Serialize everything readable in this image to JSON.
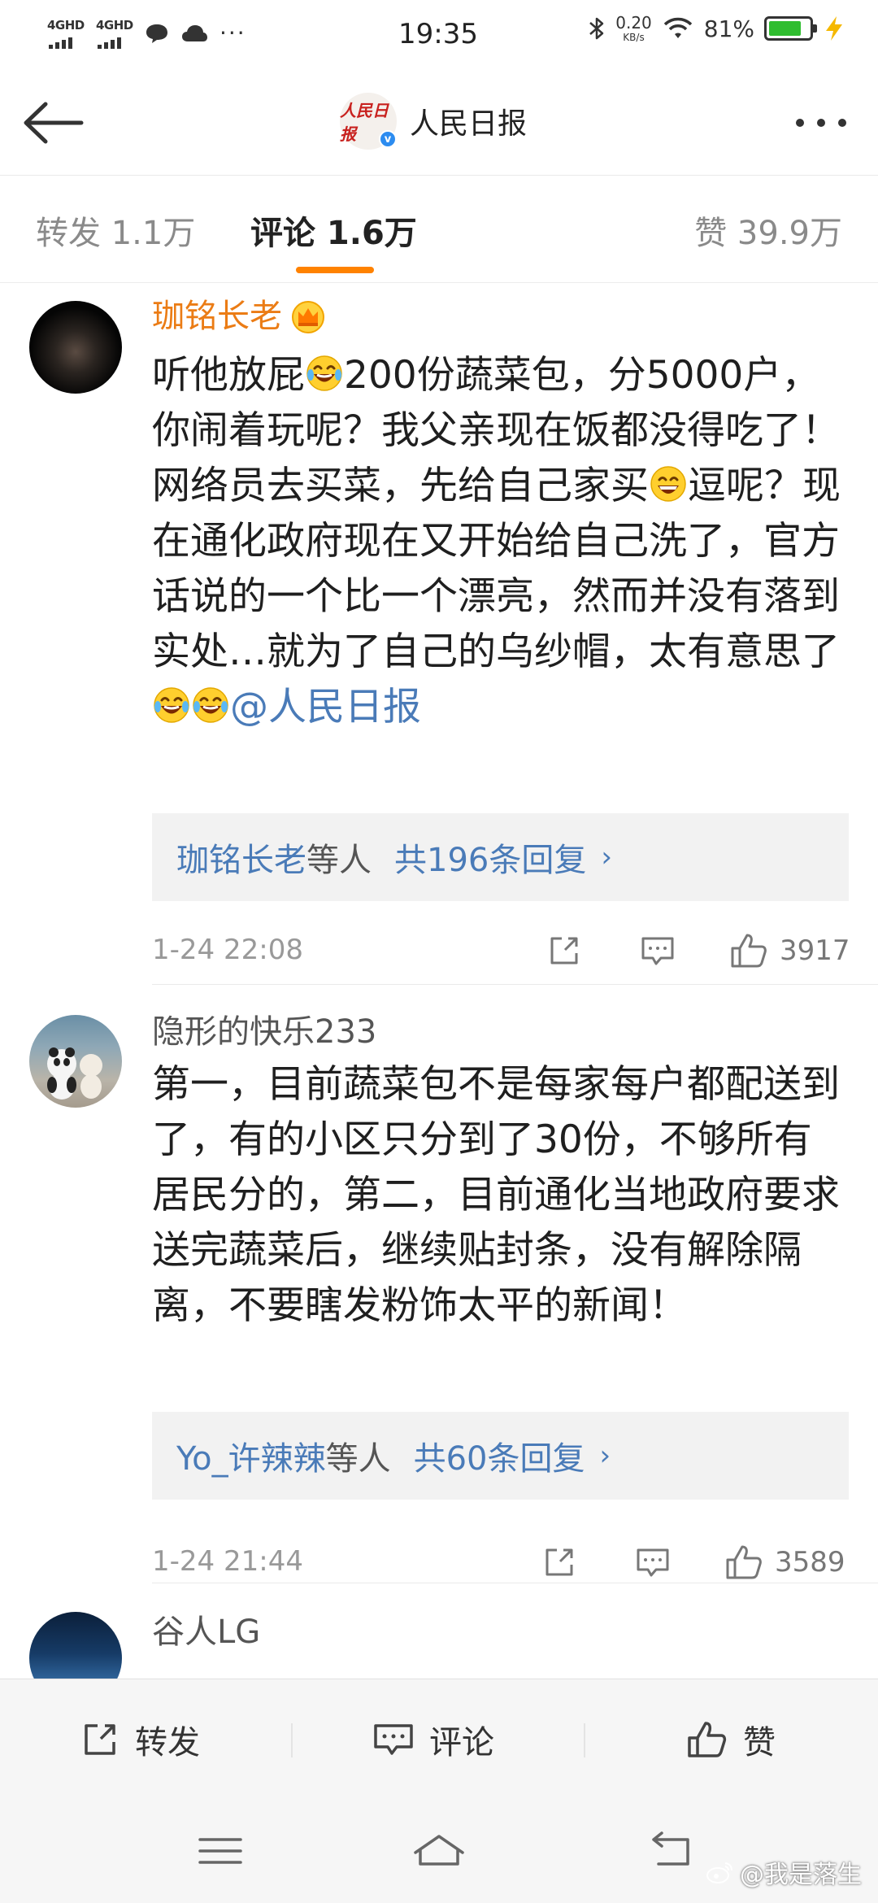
{
  "status_bar": {
    "network1": "4GHD",
    "network2": "4GHD",
    "more": "···",
    "time": "19:35",
    "speed_value": "0.20",
    "speed_unit": "KB/s",
    "battery_pct": "81%",
    "battery_level": 0.81,
    "battery_color": "#2fbd2f"
  },
  "header": {
    "account_logo_text": "人民日报",
    "account_name": "人民日报",
    "verified_mark": "v"
  },
  "tabs": [
    {
      "label": "转发 1.1万",
      "active": false
    },
    {
      "label": "评论 1.6万",
      "active": true
    },
    {
      "label": "赞 39.9万",
      "active": false
    }
  ],
  "accent_color": "#ff8200",
  "comments": [
    {
      "user": "珈铭长老",
      "badge_icon": "crown-icon",
      "text_parts": [
        "听他放屁",
        "200份蔬菜包，分5000户，你闹着玩呢？我父亲现在饭都没得吃了！网络员去买菜，先给自己家买",
        "逗呢？现在通化政府现在又开始给自己洗了，官方话说的一个比一个漂亮，然而并没有落到实处…就为了自己的乌纱帽，太有意思了",
        "@人民日报"
      ],
      "reply_user": "珈铭长老",
      "reply_mid": "等人",
      "reply_count": "共196条回复",
      "time": "1-24 22:08",
      "likes": "3917"
    },
    {
      "user": "隐形的快乐233",
      "text": "第一，目前蔬菜包不是每家每户都配送到了，有的小区只分到了30份，不够所有居民分的，第二，目前通化当地政府要求送完蔬菜后，继续贴封条，没有解除隔离，不要瞎发粉饰太平的新闻！",
      "reply_user": "Yo_许辣辣",
      "reply_mid": "等人",
      "reply_count": "共60条回复",
      "time": "1-24 21:44",
      "likes": "3589"
    },
    {
      "user": "谷人LG"
    }
  ],
  "action_bar": {
    "repost": "转发",
    "comment": "评论",
    "like": "赞"
  },
  "watermark": "@我是落生"
}
